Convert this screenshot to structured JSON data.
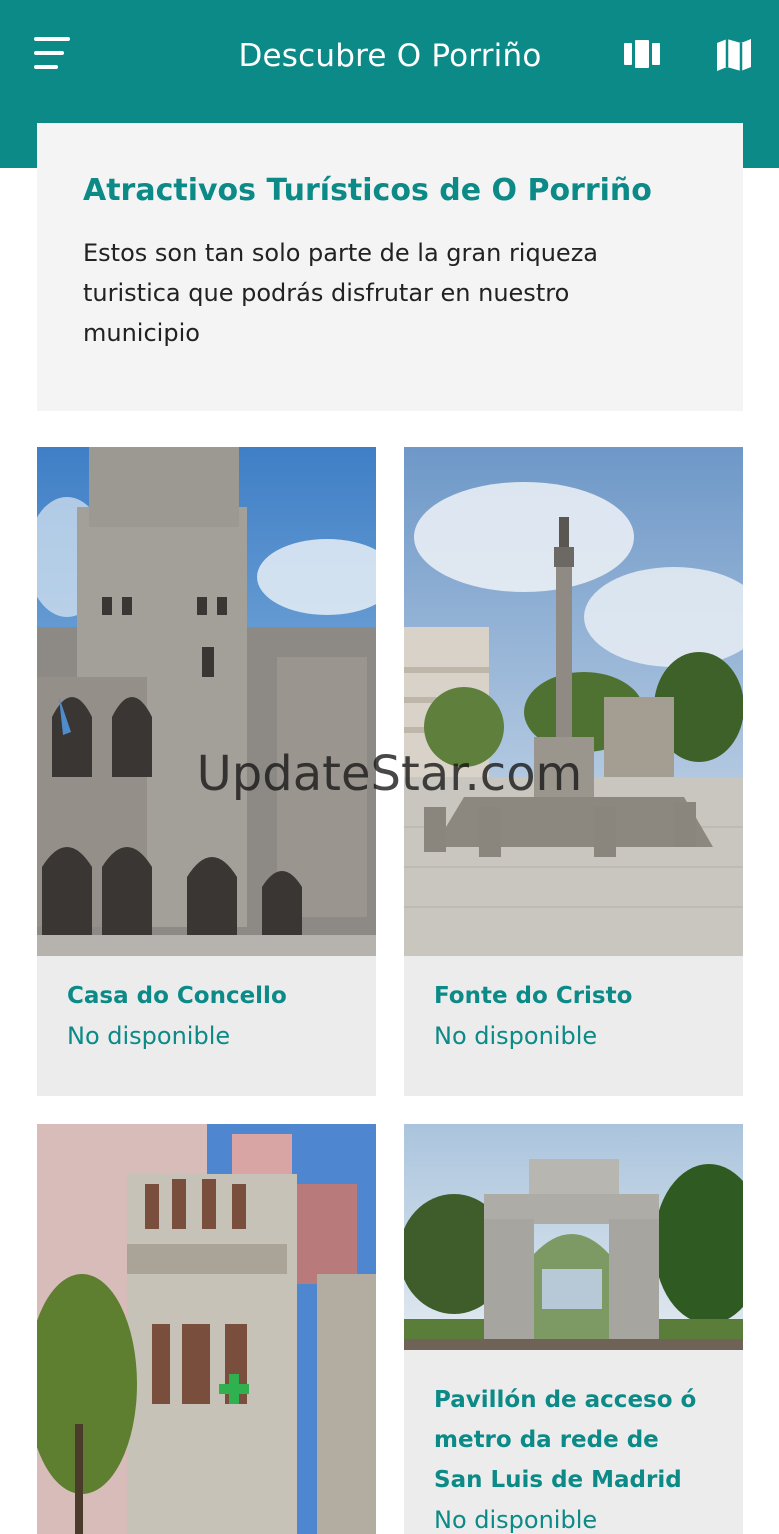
{
  "header": {
    "title": "Descubre O Porriño",
    "menu_icon": "hamburger-menu-icon",
    "gallery_icon": "gallery-icon",
    "map_icon": "map-icon",
    "bar_color": "#0b8a87"
  },
  "intro": {
    "title": "Atractivos Turísticos de O Porriño",
    "text": "Estos son tan solo parte de la gran riqueza turistica que podrás disfrutar en nuestro municipio"
  },
  "attractions": [
    {
      "name": "Casa do Concello",
      "status": "No disponible"
    },
    {
      "name": "Fonte do Cristo",
      "status": "No disponible"
    },
    {
      "name": "",
      "status": ""
    },
    {
      "name": "Pavillón de acceso ó metro da rede de San Luis de Madrid",
      "status": "No disponible"
    }
  ],
  "watermark": "UpdateStar.com",
  "colors": {
    "accent": "#0b8a87",
    "card_bg": "#ececec",
    "intro_bg": "#f4f4f4"
  }
}
